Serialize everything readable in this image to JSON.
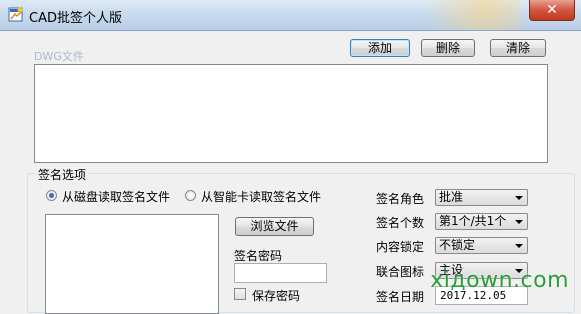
{
  "window": {
    "title": "CAD批签个人版",
    "close_glyph": "✕"
  },
  "toolbar": {
    "add_label": "添加",
    "delete_label": "删除",
    "clear_label": "清除"
  },
  "dwg": {
    "label": "DWG文件"
  },
  "options": {
    "group_title": "签名选项",
    "radio_disk": "从磁盘读取签名文件",
    "radio_smartcard": "从智能卡读取签名文件",
    "browse_label": "浏览文件",
    "password_label": "签名密码",
    "password_value": "",
    "save_password_label": "保存密码",
    "role_label": "签名角色",
    "role_value": "批准",
    "count_label": "签名个数",
    "count_value": "第1个/共1个",
    "lock_label": "内容锁定",
    "lock_value": "不锁定",
    "layer_label": "联合图标",
    "layer_value": "主设",
    "date_label": "签名日期",
    "date_value": "2017.12.05"
  },
  "watermark": "xiдown.com",
  "colors": {
    "dialog_bg": "#f0f0f0",
    "accent_blue": "#3c7fb1",
    "close_red": "#c2371f"
  }
}
